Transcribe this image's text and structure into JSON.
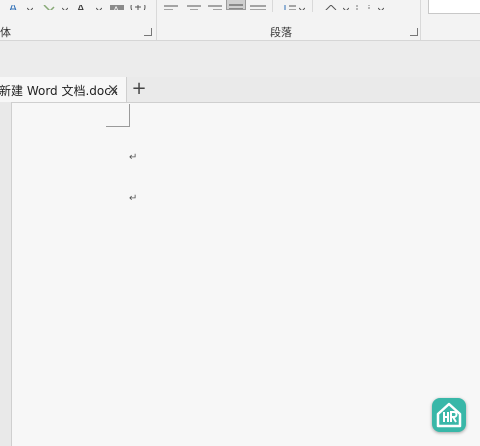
{
  "ribbon": {
    "font_group_label": "体",
    "paragraph_group_label": "段落",
    "icons": [
      "font-style-icon",
      "highlight-icon",
      "font-color-icon",
      "char-shading-icon",
      "enclosed-char-icon",
      "align-left-icon",
      "align-center-icon",
      "align-right-icon",
      "justify-icon",
      "distributed-icon",
      "line-spacing-icon",
      "shading-icon",
      "border-icon"
    ]
  },
  "tabs": [
    {
      "title": "新建 Word 文档.docx",
      "close_glyph": "×"
    }
  ],
  "new_tab_glyph": "+",
  "document": {
    "paragraph_marks": [
      "↵",
      "↵"
    ]
  },
  "colors": {
    "highlight": "#f7e600",
    "font_color": "#e02020",
    "logo": "#39b7a8"
  }
}
